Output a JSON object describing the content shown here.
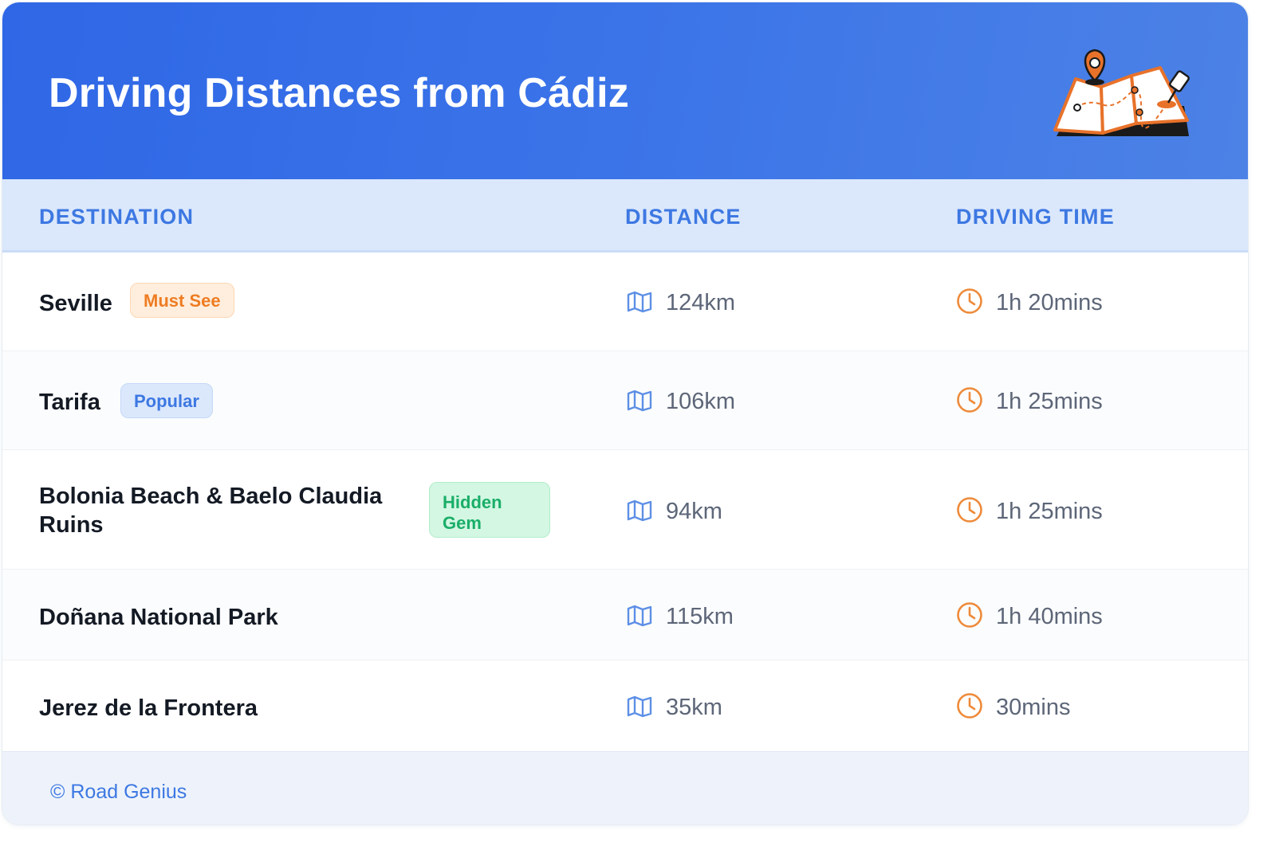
{
  "header": {
    "title": "Driving Distances from Cádiz",
    "illustration": "map-with-pins-icon"
  },
  "columns": {
    "destination": "DESTINATION",
    "distance": "DISTANCE",
    "driving_time": "DRIVING TIME"
  },
  "rows": [
    {
      "destination": "Seville",
      "badge": "Must See",
      "badge_color": "#ee7c22",
      "distance": "124km",
      "time": "1h 20mins"
    },
    {
      "destination": "Tarifa",
      "badge": "Popular",
      "badge_color": "#3d78e2",
      "distance": "106km",
      "time": "1h 25mins"
    },
    {
      "destination": "Bolonia Beach & Baelo Claudia Ruins",
      "badge": "Hidden Gem",
      "badge_color": "#1aae68",
      "distance": "94km",
      "time": "1h 25mins"
    },
    {
      "destination": "Doñana National Park",
      "badge": "",
      "distance": "115km",
      "time": "1h 40mins"
    },
    {
      "destination": "Jerez de la Frontera",
      "badge": "",
      "distance": "35km",
      "time": "30mins"
    }
  ],
  "icons": {
    "distance": "map-icon",
    "time": "clock-icon"
  },
  "colors": {
    "header_bg": "#2f67e6",
    "accent": "#3d78e2",
    "clock": "#ee8a3a",
    "map_icon": "#5d8fe6"
  },
  "footer": {
    "text": "© Road Genius"
  }
}
